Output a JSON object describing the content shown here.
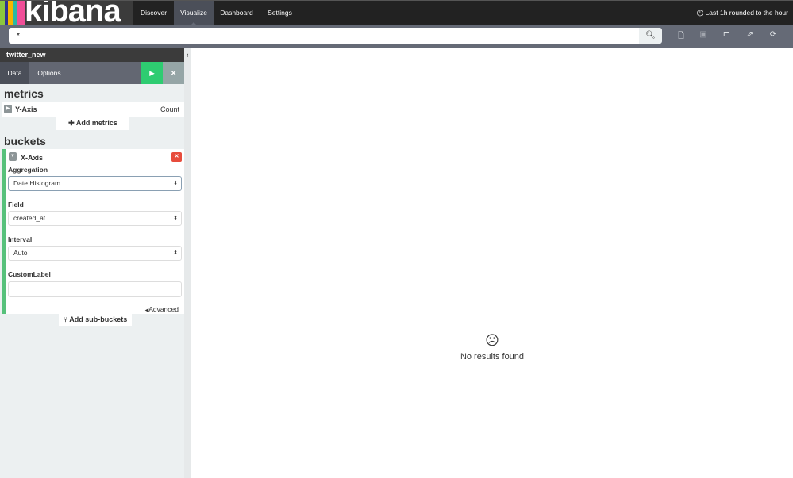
{
  "brand": {
    "name": "kibana",
    "bar_colors": [
      "#8cc63f",
      "#2e3192",
      "#f6b500",
      "#29b8a6",
      "#f04e98"
    ]
  },
  "nav": [
    {
      "label": "Discover"
    },
    {
      "label": "Visualize",
      "active": true
    },
    {
      "label": "Dashboard"
    },
    {
      "label": "Settings"
    }
  ],
  "time_picker": {
    "label": "Last 1h rounded to the hour"
  },
  "search": {
    "value": "*"
  },
  "toolbar": [
    "new-visualization-icon",
    "save-icon",
    "open-icon",
    "share-icon",
    "refresh-icon"
  ],
  "sidebar": {
    "index": "twitter_new",
    "tabs": [
      {
        "label": "Data",
        "active": true
      },
      {
        "label": "Options"
      }
    ],
    "metrics": {
      "heading": "metrics",
      "item": {
        "label": "Y-Axis",
        "value": "Count"
      },
      "add_label": "Add metrics"
    },
    "buckets": {
      "heading": "buckets",
      "item": "X-Axis",
      "aggregation": {
        "label": "Aggregation",
        "value": "Date Histogram"
      },
      "field": {
        "label": "Field",
        "value": "created_at"
      },
      "interval": {
        "label": "Interval",
        "value": "Auto"
      },
      "custom_label": {
        "label": "CustomLabel",
        "value": ""
      },
      "advanced": "Advanced",
      "add_label": "Add sub-buckets"
    }
  },
  "main": {
    "message": "No results found"
  },
  "colors": {
    "apply": "#2ecc71",
    "discard": "#95a5a6",
    "remove": "#e74c3c",
    "bucket_accent": "#57c17b"
  }
}
